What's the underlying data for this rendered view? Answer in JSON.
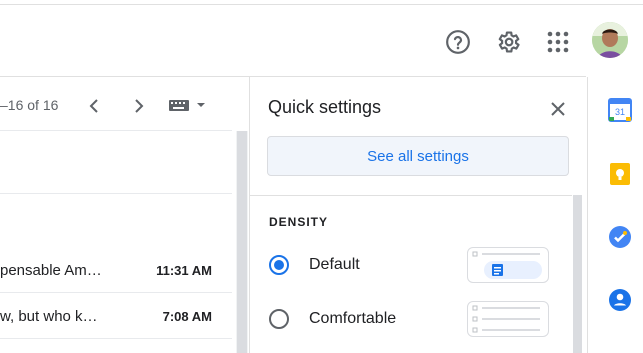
{
  "header": {
    "help_icon": "help-circle-icon",
    "settings_icon": "gear-icon",
    "apps_icon": "apps-grid-icon",
    "avatar": "user-avatar"
  },
  "mail": {
    "pagination": "–16 of 16",
    "rows": [
      {
        "snippet": "pensable Am…",
        "time": "11:31 AM"
      },
      {
        "snippet": "w, but who k…",
        "time": "7:08 AM"
      }
    ]
  },
  "quick_settings": {
    "title": "Quick settings",
    "see_all": "See all settings",
    "density_heading": "DENSITY",
    "options": [
      {
        "label": "Default",
        "selected": true
      },
      {
        "label": "Comfortable",
        "selected": false
      }
    ]
  },
  "side_panel": {
    "apps": [
      "calendar-icon",
      "keep-icon",
      "tasks-icon",
      "contacts-icon"
    ],
    "calendar_day": "31"
  },
  "colors": {
    "accent": "#1a73e8",
    "keep": "#fbbc04",
    "contacts": "#1a73e8"
  }
}
